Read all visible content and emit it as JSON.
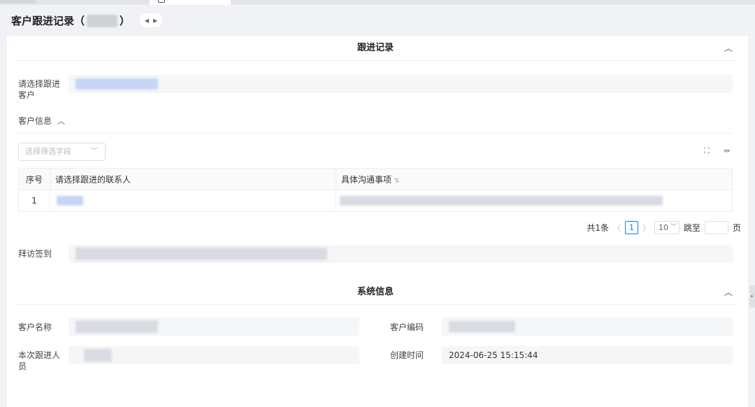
{
  "header": {
    "title_prefix": "客户跟进记录（",
    "title_suffix": "）"
  },
  "follow_section": {
    "title": "跟进记录",
    "customer_label": "请选择跟进客户",
    "customer_info_label": "客户信息",
    "filter_placeholder": "选择筛选字段",
    "table": {
      "columns": [
        "序号",
        "请选择跟进的联系人",
        "具体沟通事项"
      ],
      "rows": [
        {
          "index": "1"
        }
      ]
    },
    "pagination": {
      "total": "共1条",
      "current_page": "1",
      "page_size": "10",
      "goto_label": "跳至",
      "page_unit": "页"
    },
    "visit_label": "拜访签到"
  },
  "system_section": {
    "title": "系统信息",
    "customer_name_label": "客户名称",
    "customer_code_label": "客户编码",
    "follower_label": "本次跟进人员",
    "created_time_label": "创建时间",
    "created_time_value": "2024-06-25 15:15:44"
  },
  "colors": {
    "accent": "#1677ff",
    "panel_bg": "#ffffff",
    "page_bg": "#f0f2f5"
  },
  "icons": [
    "chevron-up-icon",
    "chevron-left-icon",
    "chevron-right-icon",
    "fullscreen-icon",
    "column-resize-icon",
    "sort-icon",
    "dropdown-icon"
  ]
}
